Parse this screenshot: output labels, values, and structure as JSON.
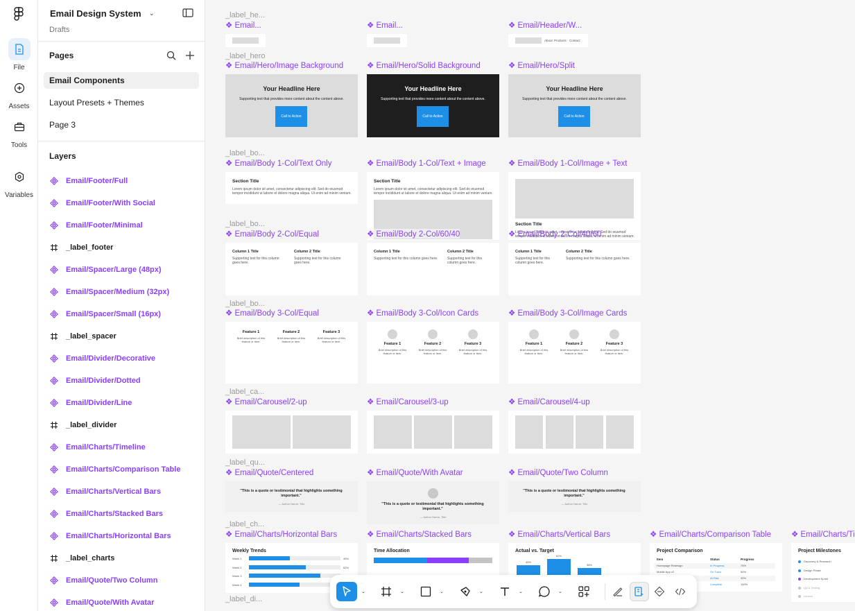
{
  "rail": {
    "items": [
      {
        "label": "File",
        "icon": "file-icon"
      },
      {
        "label": "Assets",
        "icon": "assets-icon"
      },
      {
        "label": "Tools",
        "icon": "tools-icon"
      },
      {
        "label": "Variables",
        "icon": "variables-icon"
      }
    ]
  },
  "file": {
    "title": "Email Design System",
    "subtitle": "Drafts"
  },
  "pages": {
    "heading": "Pages",
    "items": [
      "Email Components",
      "Layout Presets + Themes",
      "Page 3"
    ]
  },
  "layers": {
    "heading": "Layers",
    "items": [
      {
        "label": "Email/Footer/Full",
        "type": "component"
      },
      {
        "label": "Email/Footer/With Social",
        "type": "component"
      },
      {
        "label": "Email/Footer/Minimal",
        "type": "component"
      },
      {
        "label": "_label_footer",
        "type": "frame"
      },
      {
        "label": "Email/Spacer/Large (48px)",
        "type": "component"
      },
      {
        "label": "Email/Spacer/Medium (32px)",
        "type": "component"
      },
      {
        "label": "Email/Spacer/Small (16px)",
        "type": "component"
      },
      {
        "label": "_label_spacer",
        "type": "frame"
      },
      {
        "label": "Email/Divider/Decorative",
        "type": "component"
      },
      {
        "label": "Email/Divider/Dotted",
        "type": "component"
      },
      {
        "label": "Email/Divider/Line",
        "type": "component"
      },
      {
        "label": "_label_divider",
        "type": "frame"
      },
      {
        "label": "Email/Charts/Timeline",
        "type": "component"
      },
      {
        "label": "Email/Charts/Comparison Table",
        "type": "component"
      },
      {
        "label": "Email/Charts/Vertical Bars",
        "type": "component"
      },
      {
        "label": "Email/Charts/Stacked Bars",
        "type": "component"
      },
      {
        "label": "Email/Charts/Horizontal Bars",
        "type": "component"
      },
      {
        "label": "_label_charts",
        "type": "frame"
      },
      {
        "label": "Email/Quote/Two Column",
        "type": "component"
      },
      {
        "label": "Email/Quote/With Avatar",
        "type": "component"
      }
    ]
  },
  "canvas": {
    "section_labels": {
      "header": "_label_he...",
      "hero": "_label_hero",
      "body1": "_label_bo...",
      "body2": "_label_bo...",
      "body3": "_label_bo...",
      "carousel": "_label_ca...",
      "quote": "_label_qu...",
      "charts": "_label_ch...",
      "divider": "_label_di..."
    },
    "header_components": [
      "❖ Email...",
      "❖ Email...",
      "❖ Email/Header/W..."
    ],
    "header_nav": [
      "About",
      "Products",
      "Contact"
    ],
    "hero_components": [
      "❖ Email/Hero/Image Background",
      "❖ Email/Hero/Solid Background",
      "❖ Email/Hero/Split"
    ],
    "hero": {
      "headline": "Your Headline Here",
      "subtext": "Supporting text that provides more content about the content above.",
      "cta": "Call to Action"
    },
    "body1_components": [
      "❖ Email/Body 1-Col/Text Only",
      "❖ Email/Body 1-Col/Text + Image",
      "❖ Email/Body 1-Col/Image + Text"
    ],
    "body1": {
      "section_title": "Section Title",
      "text": "Lorem ipsum dolor sit amet, consectetur adipiscing elit. Sed do eiusmod tempor incididunt ut labore et dolore magna aliqua. Ut enim ad minim veniam."
    },
    "body2_components": [
      "❖ Email/Body 2-Col/Equal",
      "❖ Email/Body 2-Col/60/40",
      "❖ Email/Body 2-Col/40/60"
    ],
    "body2": {
      "col1_title": "Column 1 Title",
      "col2_title": "Column 2 Title",
      "text": "Supporting text for this column goes here."
    },
    "body3_components": [
      "❖ Email/Body 3-Col/Equal",
      "❖ Email/Body 3-Col/Icon Cards",
      "❖ Email/Body 3-Col/Image Cards"
    ],
    "body3": {
      "features": [
        "Feature 1",
        "Feature 2",
        "Feature 3"
      ],
      "text": "Brief description of this feature or item."
    },
    "carousel_components": [
      "❖ Email/Carousel/2-up",
      "❖ Email/Carousel/3-up",
      "❖ Email/Carousel/4-up"
    ],
    "quote_components": [
      "❖ Email/Quote/Centered",
      "❖ Email/Quote/With Avatar",
      "❖ Email/Quote/Two Column"
    ],
    "quote": {
      "text": "\"This is a quote or testimonial that highlights something important.\"",
      "author": "— Author Name, Title"
    },
    "charts_components": [
      "❖ Email/Charts/Horizontal Bars",
      "❖ Email/Charts/Stacked Bars",
      "❖ Email/Charts/Vertical Bars",
      "❖ Email/Charts/Comparison Table",
      "❖ Email/Charts/Ti"
    ],
    "hbar": {
      "title": "Weekly Trends",
      "rows": [
        {
          "label": "Week 1",
          "value": 45,
          "pct": "45%"
        },
        {
          "label": "Week 2",
          "value": 62,
          "pct": "62%"
        },
        {
          "label": "Week 3",
          "value": 78,
          "pct": ""
        },
        {
          "label": "Week 4",
          "value": 55,
          "pct": ""
        }
      ]
    },
    "stacked": {
      "title": "Time Allocation",
      "segments": [
        45,
        35,
        20
      ]
    },
    "vbar": {
      "title": "Actual vs. Target",
      "bars": [
        {
          "label": "45%",
          "value": 45
        },
        {
          "label": "62%",
          "value": 62
        },
        {
          "label": "38%",
          "value": 38
        }
      ]
    },
    "table": {
      "title": "Project Comparison",
      "headers": [
        "Item",
        "Status",
        "Progress"
      ],
      "rows": [
        [
          "Homepage Redesign",
          "In Progress",
          "75%"
        ],
        [
          "Mobile App v2",
          "On Track",
          "50%"
        ],
        [
          "",
          "At Risk",
          "30%"
        ],
        [
          "",
          "Complete",
          "100%"
        ]
      ]
    },
    "milestones": {
      "title": "Project Milestones",
      "items": [
        "Discovery & Research",
        "Design Phase",
        "Development Sprint",
        "QA & Testing",
        "Launch"
      ]
    }
  },
  "colors": {
    "accent": "#1e8fe6",
    "component": "#8a3ffc",
    "purple_bar": "#8a3ffc",
    "gray_bar": "#c4c4c4"
  }
}
